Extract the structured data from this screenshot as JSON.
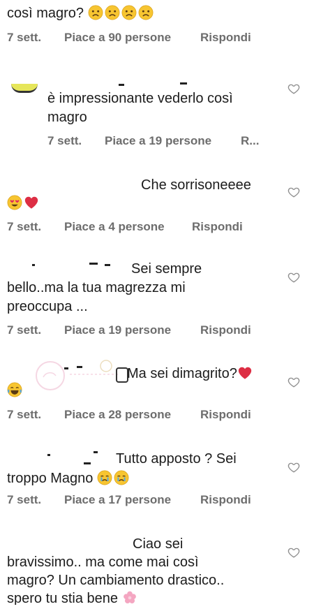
{
  "comments": [
    {
      "text_line1": "così magro?",
      "meta_time": "7 sett.",
      "meta_likes": "Piace a 90 persone",
      "meta_reply": "Rispondi"
    },
    {
      "text": "è impressionante vederlo così magro",
      "meta_time": "7 sett.",
      "meta_likes": "Piace a 19 persone",
      "meta_reply": "R..."
    },
    {
      "text": "Che sorrisoneeee",
      "meta_time": "7 sett.",
      "meta_likes": "Piace a 4 persone",
      "meta_reply": "Rispondi"
    },
    {
      "text_line1": "Sei sempre",
      "text_line2": "bello..ma la tua magrezza mi",
      "text_line3": "preoccupa ...",
      "meta_time": "7 sett.",
      "meta_likes": "Piace a 19 persone",
      "meta_reply": "Rispondi"
    },
    {
      "text": "Ma sei dimagrito?",
      "meta_time": "7 sett.",
      "meta_likes": "Piace a 28 persone",
      "meta_reply": "Rispondi"
    },
    {
      "text_line1": "Tutto apposto ? Sei",
      "text_line2": "troppo Magno",
      "meta_time": "7 sett.",
      "meta_likes": "Piace a 17 persone",
      "meta_reply": "Rispondi"
    },
    {
      "text_line1": "Ciao sei",
      "text_line2": "bravissimo.. ma come mai così",
      "text_line3": "magro? Un cambiamento drastico..",
      "text_line4": "spero tu stia bene"
    }
  ],
  "icons": {
    "like": "heart-outline-icon",
    "sad": "sad-face-emoji",
    "heart_eyes": "heart-eyes-emoji",
    "red_heart": "red-heart-emoji",
    "laugh": "tears-of-joy-emoji",
    "cry": "crying-face-emoji",
    "blossom": "cherry-blossom-emoji"
  },
  "colors": {
    "meta": "#6d6d6d",
    "text": "#1c1c1c",
    "heart_outline": "#8e8e8e"
  }
}
